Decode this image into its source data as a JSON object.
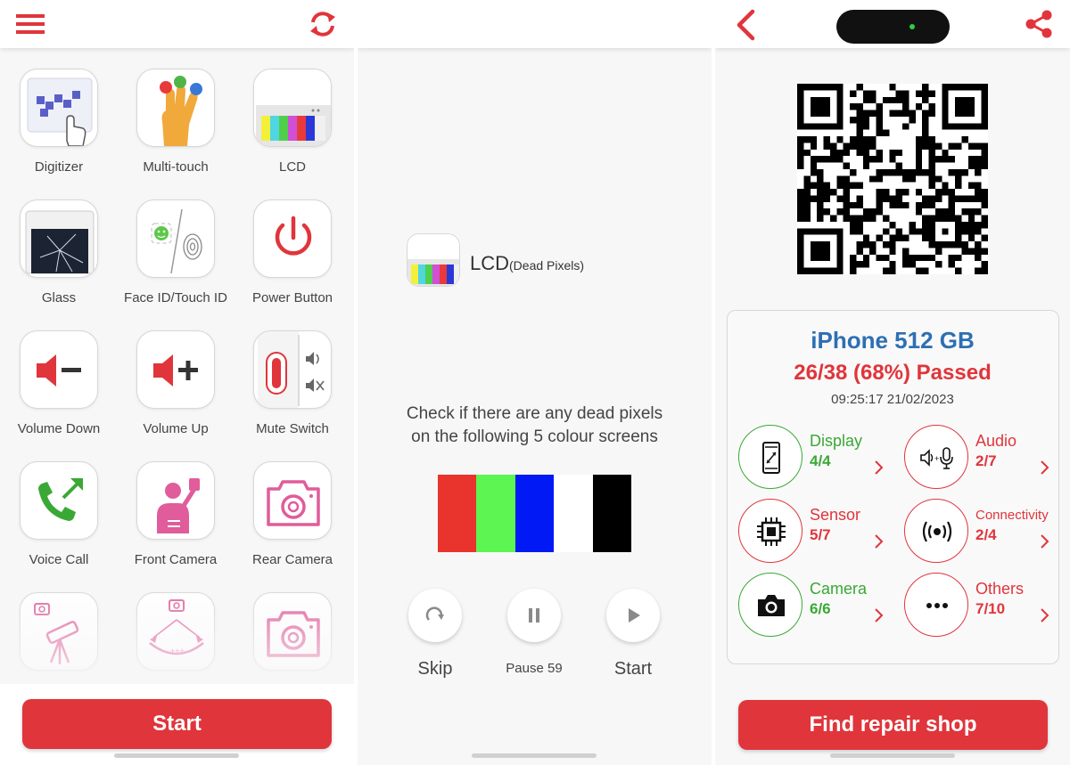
{
  "colors": {
    "accent": "#e0353b",
    "model_blue": "#2d6fb3",
    "pass_green": "#3aa835"
  },
  "screen1": {
    "menu_icon": "hamburger-menu-icon",
    "refresh_icon": "refresh-icon",
    "tests": [
      {
        "label": "Digitizer",
        "icon": "digitizer-icon"
      },
      {
        "label": "Multi-touch",
        "icon": "multi-touch-icon"
      },
      {
        "label": "LCD",
        "icon": "lcd-icon"
      },
      {
        "label": "Glass",
        "icon": "cracked-glass-icon"
      },
      {
        "label": "Face ID/Touch ID",
        "icon": "face-id-touch-id-icon"
      },
      {
        "label": "Power Button",
        "icon": "power-icon"
      },
      {
        "label": "Volume Down",
        "icon": "volume-down-icon"
      },
      {
        "label": "Volume Up",
        "icon": "volume-up-icon"
      },
      {
        "label": "Mute Switch",
        "icon": "mute-switch-icon"
      },
      {
        "label": "Voice Call",
        "icon": "phone-call-icon"
      },
      {
        "label": "Front Camera",
        "icon": "selfie-icon"
      },
      {
        "label": "Rear Camera",
        "icon": "camera-icon"
      },
      {
        "label": "",
        "icon": "telescope-camera-icon"
      },
      {
        "label": "",
        "icon": "wide-camera-icon"
      },
      {
        "label": "",
        "icon": "camera-icon"
      }
    ],
    "start_label": "Start"
  },
  "screen2": {
    "test_title": "LCD",
    "test_subtitle": "(Dead Pixels)",
    "instruction_line1": "Check if there are any dead pixels",
    "instruction_line2": "on the following 5 colour screens",
    "swatches": [
      "#e8342c",
      "#5df552",
      "#0019f5",
      "#ffffff",
      "#000000"
    ],
    "skip_label": "Skip",
    "pause_label": "Pause 59",
    "start_label": "Start"
  },
  "screen3": {
    "model": "iPhone 512 GB",
    "result": "26/38 (68%) Passed",
    "timestamp": "09:25:17 21/02/2023",
    "categories": [
      {
        "name": "Display",
        "score": "4/4",
        "status": "pass",
        "icon": "display-icon"
      },
      {
        "name": "Audio",
        "score": "2/7",
        "status": "fail",
        "icon": "audio-mic-icon"
      },
      {
        "name": "Sensor",
        "score": "5/7",
        "status": "fail",
        "icon": "chip-icon"
      },
      {
        "name": "Connectivity",
        "score": "2/4",
        "status": "fail",
        "icon": "wireless-icon"
      },
      {
        "name": "Camera",
        "score": "6/6",
        "status": "pass",
        "icon": "camera-icon"
      },
      {
        "name": "Others",
        "score": "7/10",
        "status": "fail",
        "icon": "more-icon"
      }
    ],
    "repair_label": "Find repair shop"
  }
}
